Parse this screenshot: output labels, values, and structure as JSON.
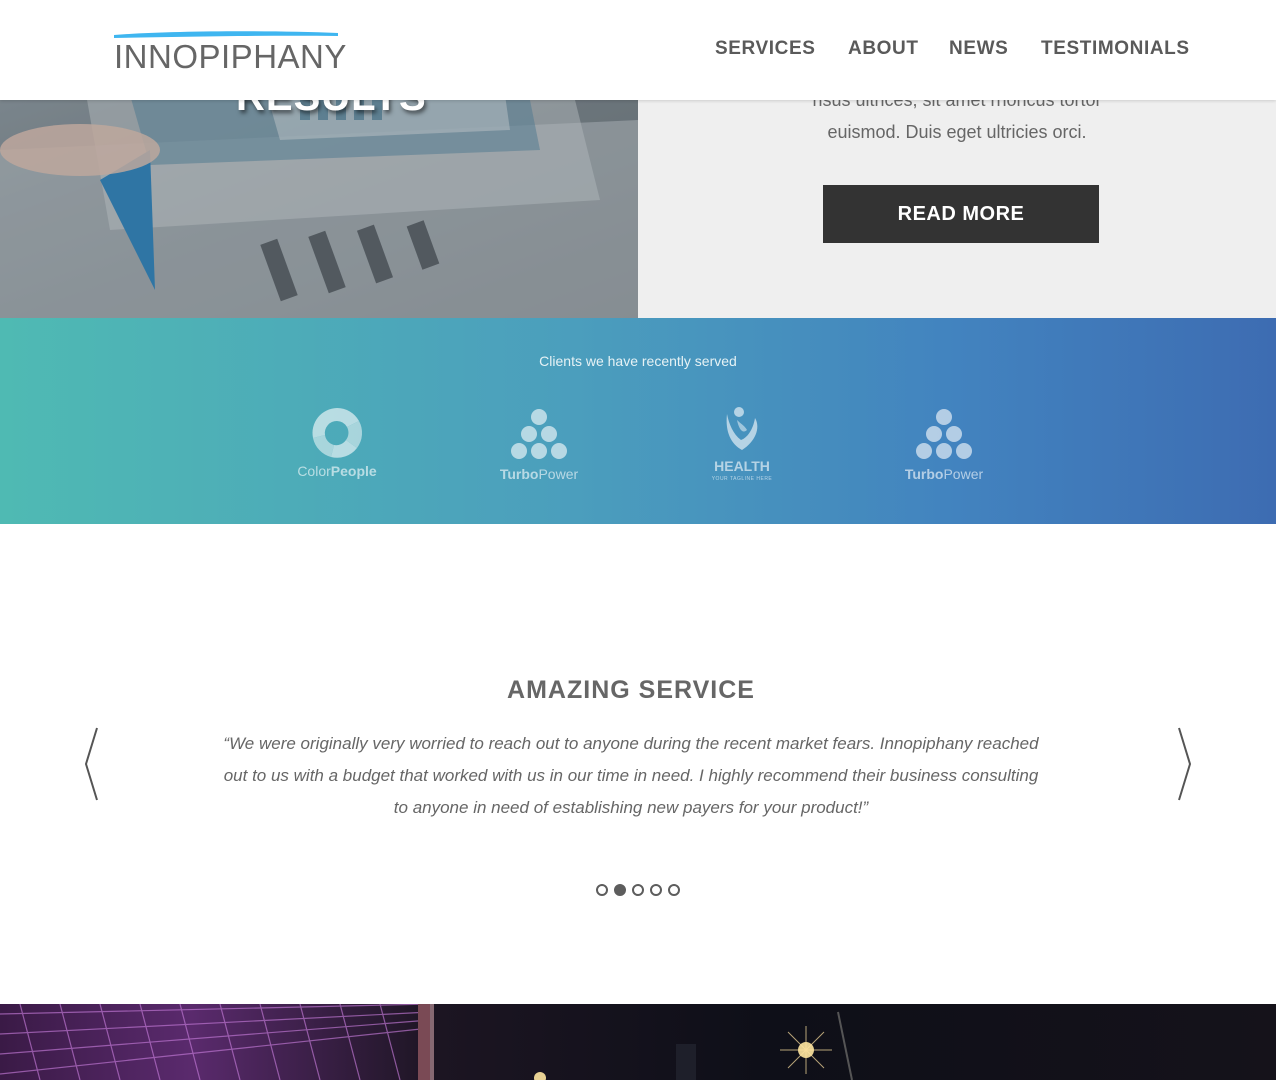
{
  "header": {
    "logo_text": "INNOPIPHANY",
    "nav": [
      "SERVICES",
      "ABOUT",
      "NEWS",
      "TESTIMONIALS"
    ]
  },
  "hero": {
    "heading": "RESULTS",
    "text_lines": [
      "risus ultrices, sit amet rhoncus tortor",
      "euismod. Duis eget ultricies orci."
    ],
    "button_label": "READ MORE"
  },
  "clients": {
    "title": "Clients we have recently served",
    "logos": [
      {
        "icon": "colorpeople-logo-icon",
        "name_light": "Color",
        "name_bold": "People"
      },
      {
        "icon": "turbopower-logo-icon",
        "name_bold": "Turbo",
        "name_light": "Power"
      },
      {
        "icon": "health-logo-icon",
        "name_bold": "HEALTH",
        "tagline": "YOUR TAGLINE HERE"
      },
      {
        "icon": "turbopower-logo-icon",
        "name_bold": "Turbo",
        "name_light": "Power"
      }
    ]
  },
  "testimonial": {
    "title": "AMAZING SERVICE",
    "quote_lines": [
      "“We were originally very worried to reach out to anyone during the recent market fears. Innopiphany reached",
      "out to us with a budget that worked with us in our time in need. I highly recommend their business consulting",
      "to anyone in need of establishing new payers for your product!”"
    ],
    "slide_count": 5,
    "active_slide": 2
  },
  "colors": {
    "brand_blue": "#3fb6f0",
    "band_start": "#4fbab3",
    "band_end": "#3d6cb2",
    "button_dark": "#333333"
  }
}
